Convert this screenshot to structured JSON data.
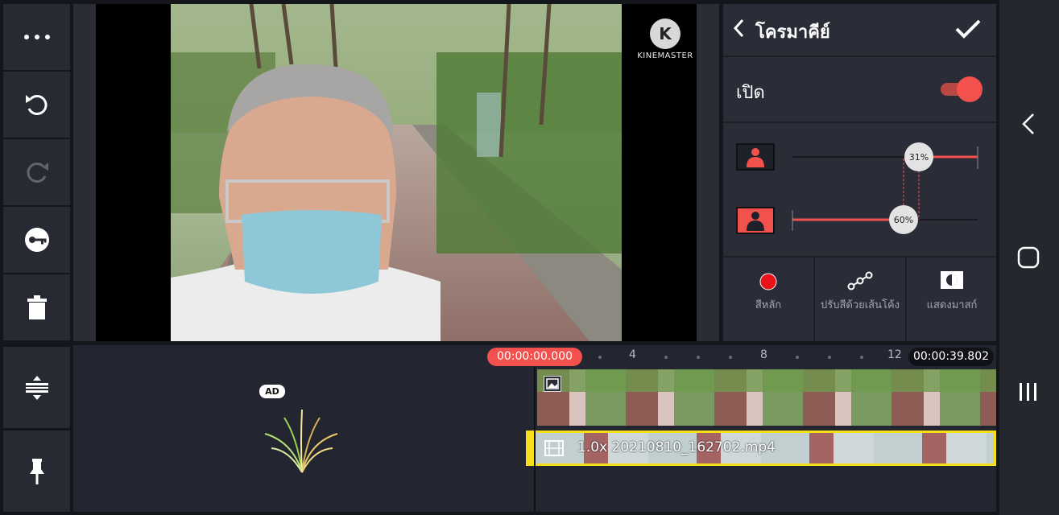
{
  "panel": {
    "title": "โครมาคีย์",
    "enable_label": "เปิด",
    "enabled": true,
    "slider_top_value": "31%",
    "slider_top_fraction": 0.31,
    "slider_bottom_value": "60%",
    "slider_bottom_fraction": 0.6,
    "buttons": [
      {
        "label": "สีหลัก",
        "icon": "record-dot-icon"
      },
      {
        "label": "ปรับสีด้วยเส้นโค้ง",
        "icon": "curve-icon"
      },
      {
        "label": "แสดงมาสก์",
        "icon": "mask-icon"
      }
    ]
  },
  "preview": {
    "watermark": "KINEMASTER",
    "watermark_logo": "K"
  },
  "timeline": {
    "current_time": "00:00:00.000",
    "total_time": "00:00:39.802",
    "ruler_labels": [
      "4",
      "8",
      "12"
    ],
    "clip_name": "1.0x 20210810_162702.mp4",
    "ad_badge": "AD"
  },
  "colors": {
    "accent": "#f2514d",
    "clip_border": "#f6de1a",
    "panel_bg": "#2a2d37"
  }
}
